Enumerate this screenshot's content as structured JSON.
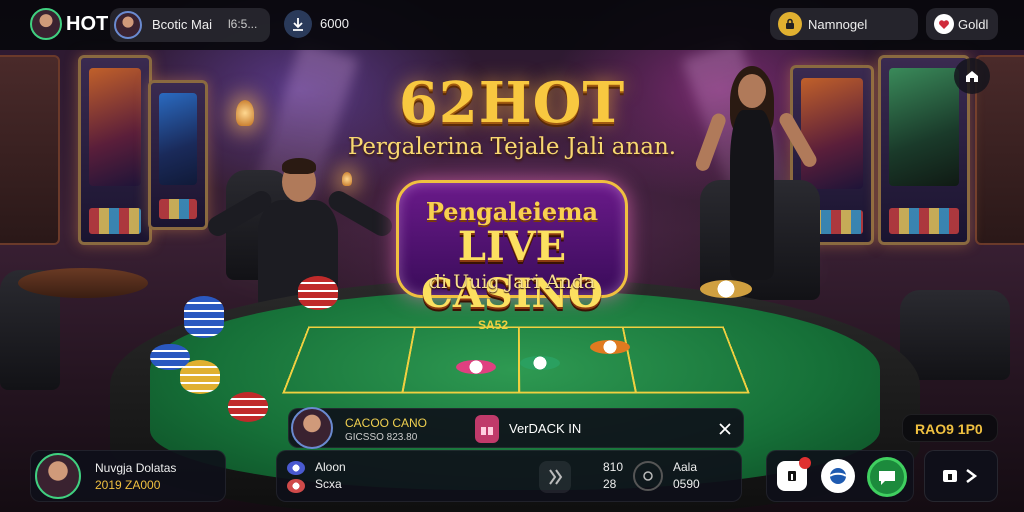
{
  "topbar": {
    "brand": "HOT",
    "user_name": "Bcotic Mai",
    "user_sub": "l6:5...",
    "balance": "6000",
    "nav_label": "Namnogel",
    "gold_label": "Goldl"
  },
  "hero": {
    "title": "62HOT",
    "subtitle": "Pergalerina Tejale Jali anan.",
    "badge_line1": "Pengaleiema",
    "badge_line2": "LIVE CASINO",
    "badge_line3": "di Uuig Jari Anda"
  },
  "table": {
    "box_label": "SA52"
  },
  "chat": {
    "dealer_name": "CACOO CANO",
    "dealer_sub": "GICSSO 823.80",
    "message": "VerDACK IN"
  },
  "odds": {
    "label": "RAO9 1P0"
  },
  "player": {
    "name": "Nuvgja Dolatas",
    "balance": "2019 ZA000"
  },
  "stats": {
    "row1_label": "Aloon",
    "row2_label": "Scxa",
    "val1_top": "810",
    "val1_bottom": "28",
    "val2_top": "Aala",
    "val2_bottom": "0590"
  },
  "colors": {
    "gold": "#f8c840",
    "accent_green": "#40d080",
    "felt": "#167038"
  }
}
